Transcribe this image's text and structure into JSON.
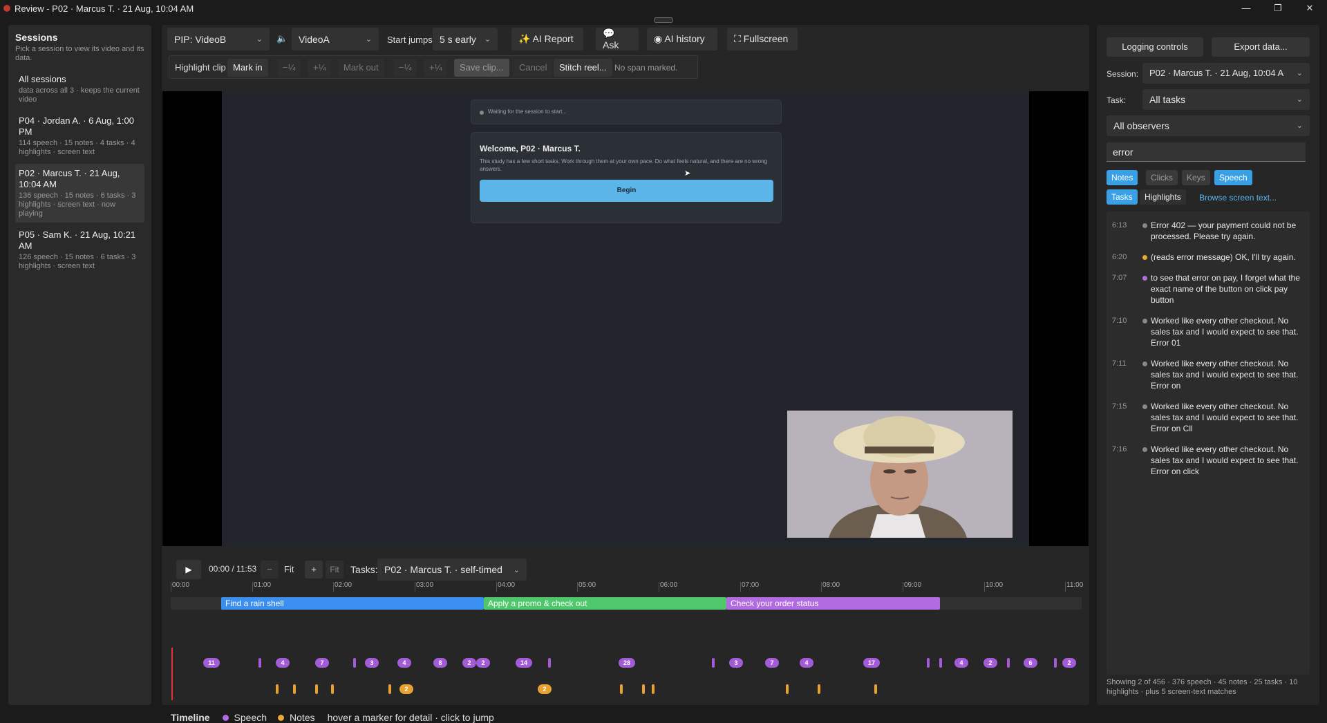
{
  "window": {
    "title": "Review - P02 · Marcus T. · 21 Aug, 10:04 AM"
  },
  "sessions": {
    "header": "Sessions",
    "subtitle": "Pick a session to view its video and its data.",
    "items": [
      {
        "title": "All sessions",
        "desc": "data across all 3 · keeps the current video",
        "selected": false
      },
      {
        "title": "P04 · Jordan A. · 6 Aug, 1:00 PM",
        "desc": "114 speech · 15 notes · 4 tasks · 4 highlights · screen text",
        "selected": false
      },
      {
        "title": "P02 · Marcus T. · 21 Aug, 10:04 AM",
        "desc": "136 speech · 15 notes · 6 tasks · 3 highlights · screen text · now playing",
        "selected": true
      },
      {
        "title": "P05 · Sam K. · 21 Aug, 10:21 AM",
        "desc": "126 speech · 15 notes · 6 tasks · 3 highlights · screen text",
        "selected": false
      }
    ]
  },
  "toolbar": {
    "pip": "PIP: VideoB",
    "video": "VideoA",
    "start_jumps_label": "Start jumps",
    "start_jumps": "5 s early",
    "ai_report": "✨ AI Report",
    "ask": "💬 Ask",
    "ai_history": "◉ AI history",
    "fullscreen": "⛶ Fullscreen"
  },
  "clip": {
    "label": "Highlight clip",
    "mark_in": "Mark in",
    "minus1": "−¼",
    "plus1": "+¼",
    "mark_out": "Mark out",
    "minus2": "−¼",
    "plus2": "+¼",
    "save": "Save clip...",
    "cancel": "Cancel",
    "stitch": "Stitch reel...",
    "status": "No span marked."
  },
  "screen": {
    "waiting": "Waiting for the session to start...",
    "welcome": "Welcome, P02 · Marcus T.",
    "body": "This study has a few short tasks. Work through them at your own pace. Do what feels natural, and there are no wrong answers.",
    "begin": "Begin"
  },
  "timeline": {
    "time": "00:00 / 11:53",
    "minus": "−",
    "fit1": "Fit",
    "plus": "+",
    "fit2": "Fit",
    "tasks_label": "Tasks:",
    "tasks_value": "P02 · Marcus T. · self-timed",
    "ticks": [
      "00:00",
      "01:00",
      "02:00",
      "03:00",
      "04:00",
      "05:00",
      "06:00",
      "07:00",
      "08:00",
      "09:00",
      "10:00",
      "11:00"
    ],
    "task_segments": [
      {
        "label": "Find a rain shell",
        "start": 0.62,
        "end": 3.85,
        "color": "#3b8ff0"
      },
      {
        "label": "Apply a promo & check out",
        "start": 3.85,
        "end": 6.83,
        "color": "#4fc86c"
      },
      {
        "label": "Check your order status",
        "start": 6.83,
        "end": 9.46,
        "color": "#b26be0"
      }
    ],
    "speech_markers": [
      {
        "t": 0.5,
        "n": "11"
      },
      {
        "t": 1.1,
        "n": ""
      },
      {
        "t": 1.38,
        "n": "4"
      },
      {
        "t": 1.86,
        "n": "7"
      },
      {
        "t": 2.26,
        "n": ""
      },
      {
        "t": 2.47,
        "n": "3"
      },
      {
        "t": 2.87,
        "n": "4"
      },
      {
        "t": 3.31,
        "n": "8"
      },
      {
        "t": 3.67,
        "n": "2"
      },
      {
        "t": 3.84,
        "n": "2"
      },
      {
        "t": 4.34,
        "n": "14"
      },
      {
        "t": 4.66,
        "n": ""
      },
      {
        "t": 5.61,
        "n": "28"
      },
      {
        "t": 6.67,
        "n": ""
      },
      {
        "t": 6.95,
        "n": "3"
      },
      {
        "t": 7.39,
        "n": "7"
      },
      {
        "t": 7.82,
        "n": "4"
      },
      {
        "t": 8.62,
        "n": "17"
      },
      {
        "t": 9.31,
        "n": ""
      },
      {
        "t": 9.47,
        "n": ""
      },
      {
        "t": 9.72,
        "n": "4"
      },
      {
        "t": 10.08,
        "n": "2"
      },
      {
        "t": 10.3,
        "n": ""
      },
      {
        "t": 10.57,
        "n": "6"
      },
      {
        "t": 10.88,
        "n": ""
      },
      {
        "t": 11.05,
        "n": "2"
      }
    ],
    "note_markers": [
      {
        "t": 1.31,
        "n": ""
      },
      {
        "t": 1.52,
        "n": ""
      },
      {
        "t": 1.79,
        "n": ""
      },
      {
        "t": 1.99,
        "n": ""
      },
      {
        "t": 2.69,
        "n": ""
      },
      {
        "t": 2.9,
        "n": "2"
      },
      {
        "t": 4.6,
        "n": "2"
      },
      {
        "t": 5.54,
        "n": ""
      },
      {
        "t": 5.81,
        "n": ""
      },
      {
        "t": 5.93,
        "n": ""
      },
      {
        "t": 7.58,
        "n": ""
      },
      {
        "t": 7.97,
        "n": ""
      },
      {
        "t": 8.67,
        "n": ""
      }
    ],
    "legend_title": "Timeline",
    "legend_speech": "Speech",
    "legend_notes": "Notes",
    "legend_hint": "hover a marker for detail · click to jump"
  },
  "right": {
    "logging": "Logging controls",
    "export": "Export data...",
    "session_label": "Session:",
    "session_value": "P02 · Marcus T. · 21 Aug, 10:04 A",
    "task_label": "Task:",
    "task_value": "All tasks",
    "observers": "All observers",
    "search_value": "error",
    "filters": {
      "notes": "Notes",
      "clicks": "Clicks",
      "keys": "Keys",
      "speech": "Speech",
      "tasks": "Tasks",
      "highlights": "Highlights",
      "browse": "Browse screen text..."
    },
    "results": [
      {
        "t": "6:13",
        "text": "Error 402 — your payment could not be processed. Please try again.",
        "color": "#888"
      },
      {
        "t": "6:20",
        "text": "(reads error message) OK, I'll try again.",
        "color": "#e8a838"
      },
      {
        "t": "7:07",
        "text": "to see that error on pay, I forget what the exact name of the button on click pay button",
        "color": "#b26be0"
      },
      {
        "t": "7:10",
        "text": "Worked like every other checkout. No sales tax and I would expect to see that. Error 01",
        "color": "#888"
      },
      {
        "t": "7:11",
        "text": "Worked like every other checkout. No sales tax and I would expect to see that. Error on",
        "color": "#888"
      },
      {
        "t": "7:15",
        "text": "Worked like every other checkout. No sales tax and I would expect to see that. Error on Cll",
        "color": "#888"
      },
      {
        "t": "7:16",
        "text": "Worked like every other checkout. No sales tax and I would expect to see that. Error on click",
        "color": "#888"
      }
    ],
    "footer": "Showing 2 of 456 · 376 speech · 45 notes · 25 tasks · 10 highlights · plus 5 screen-text matches"
  }
}
